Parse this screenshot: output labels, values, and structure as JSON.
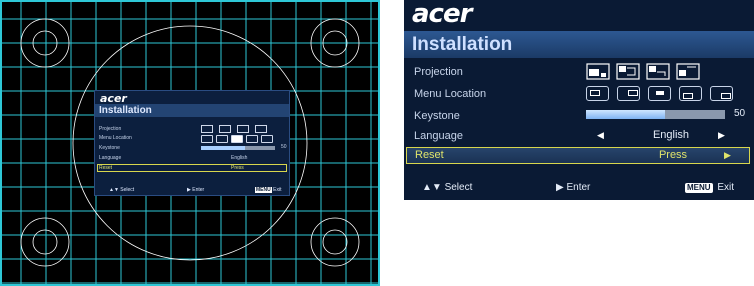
{
  "osd": {
    "logo": "acer",
    "title": "Installation",
    "rows": {
      "projection": "Projection",
      "menu_location": "Menu Location",
      "keystone": "Keystone",
      "language": "Language",
      "reset": "Reset"
    },
    "keystone_value": "50",
    "keystone_level": 0.57,
    "language_value": "English",
    "reset_value": "Press",
    "footer": {
      "select": "Select",
      "enter": "Enter",
      "menu_key": "MENU",
      "exit": "Exit"
    },
    "icons": {
      "projection": [
        "projection-front-desk-icon",
        "projection-rear-desk-icon",
        "projection-front-ceiling-icon",
        "projection-rear-ceiling-icon"
      ],
      "menu_location": [
        "menu-top-left-icon",
        "menu-top-right-icon",
        "menu-center-icon",
        "menu-bottom-left-icon",
        "menu-bottom-right-icon"
      ]
    },
    "colors": {
      "background": "#0a1a34",
      "highlight": "#e0e46b",
      "grid": "#2ec7d6"
    }
  },
  "mini_osd": {
    "logo": "acer",
    "title": "Installation",
    "rows": {
      "projection": "Projection",
      "menu_location": "Menu Location",
      "keystone": "Keystone",
      "language": "Language",
      "reset": "Reset"
    },
    "keystone_value": "50",
    "language_value": "English",
    "reset_value": "Press",
    "footer": {
      "select": "Select",
      "enter": "Enter",
      "menu_key": "MENU",
      "exit": "Exit"
    }
  }
}
